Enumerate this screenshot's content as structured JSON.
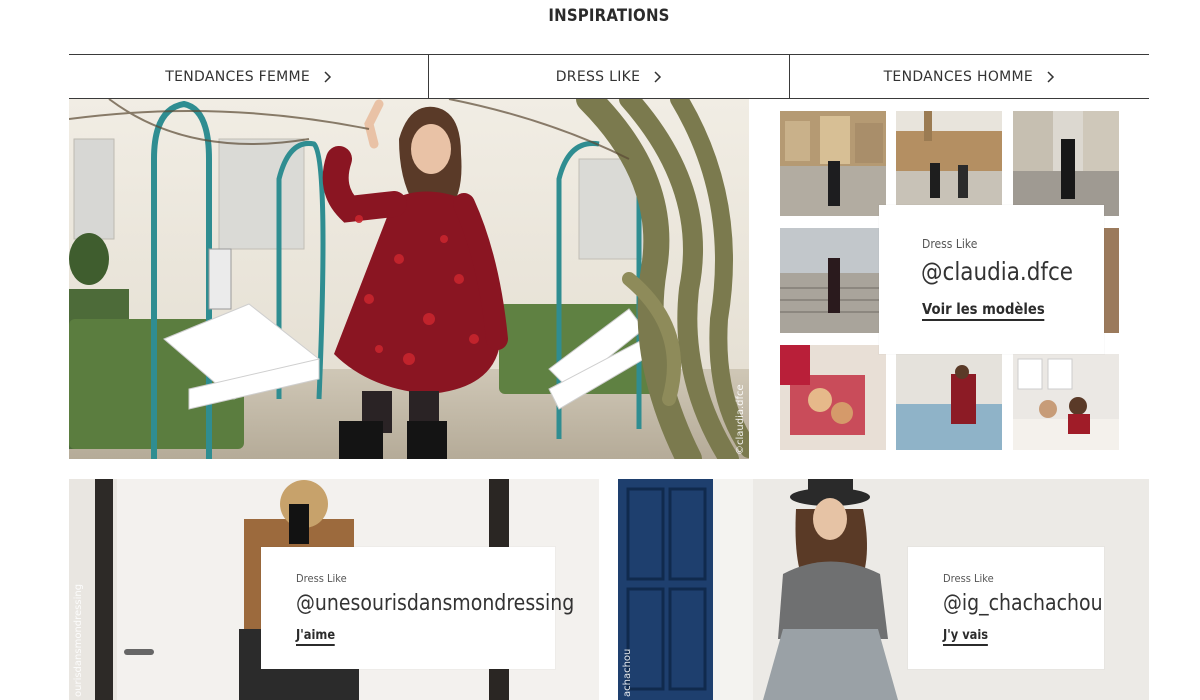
{
  "page": {
    "title": "INSPIRATIONS"
  },
  "tabs": [
    {
      "label": "TENDANCES FEMME"
    },
    {
      "label": "DRESS LIKE"
    },
    {
      "label": "TENDANCES HOMME"
    }
  ],
  "hero": {
    "credit": "©claudia.dfce"
  },
  "feature_card": {
    "kicker": "Dress Like",
    "handle": "@claudia.dfce",
    "cta": "Voir les modèles"
  },
  "card_left": {
    "kicker": "Dress Like",
    "handle": "@unesourisdansmondressing",
    "cta": "J'aime",
    "credit": "ourisdansmondressing"
  },
  "card_right": {
    "kicker": "Dress Like",
    "handle": "@ig_chachachou",
    "cta": "J'y vais",
    "credit": "achachou"
  },
  "icons": {
    "tab_arrow": "chevron-right-icon"
  },
  "colors": {
    "accent": "#2b2b2b",
    "divider": "#3a3a3a"
  }
}
